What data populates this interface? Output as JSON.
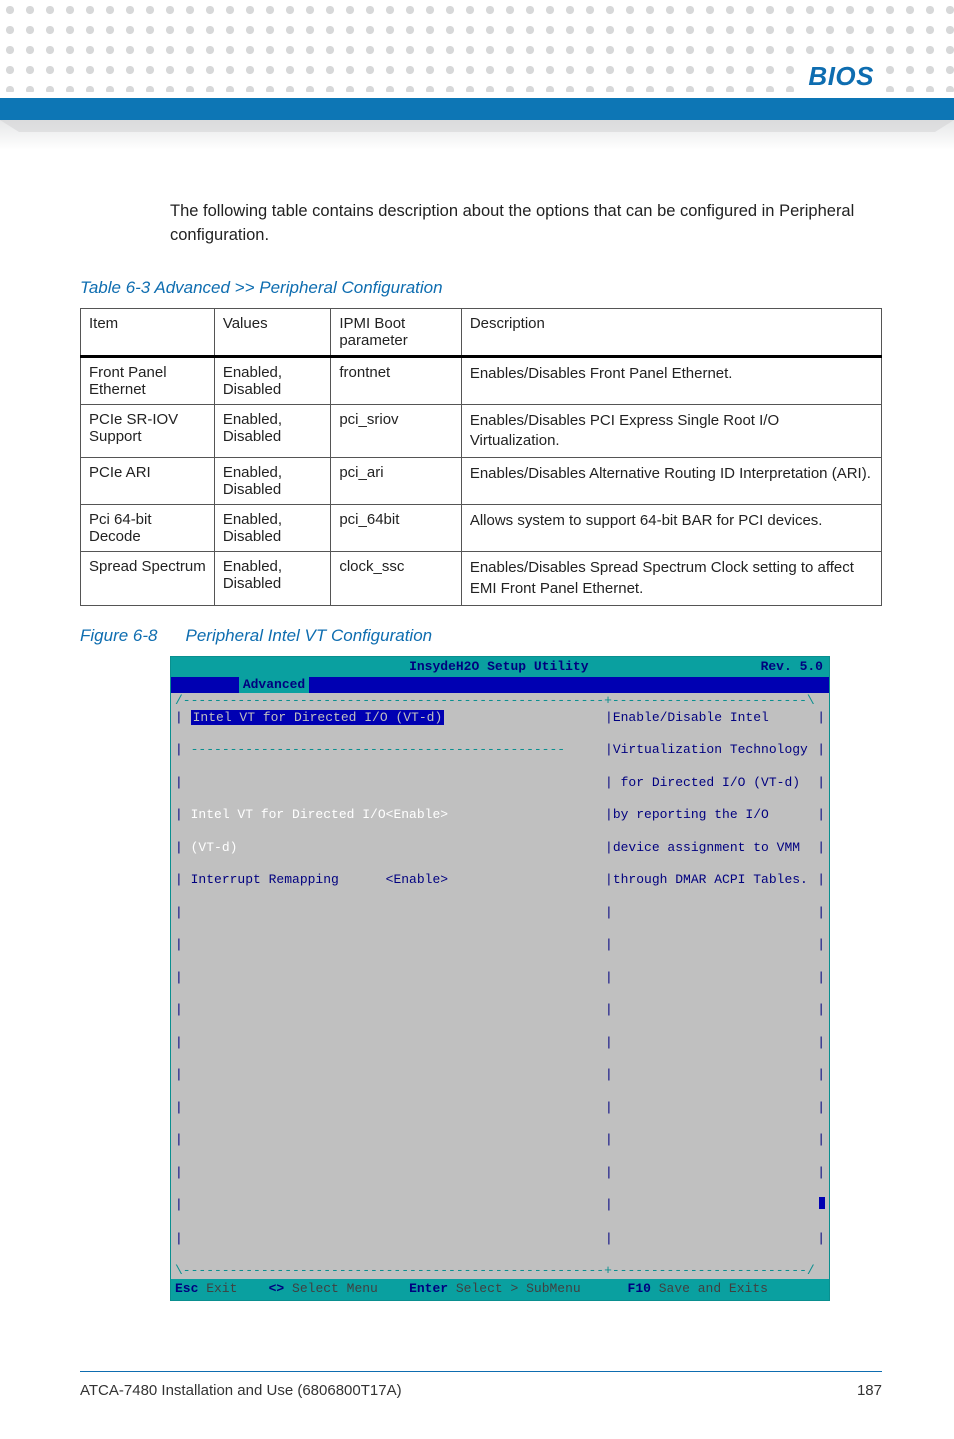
{
  "header": {
    "section": "BIOS"
  },
  "intro": "The following table contains description about the options that can be configured in Peripheral configuration.",
  "table_caption": "Table 6-3 Advanced >> Peripheral Configuration",
  "table": {
    "headers": [
      "Item",
      "Values",
      "IPMI Boot parameter",
      "Description"
    ],
    "rows": [
      {
        "item": "Front Panel Ethernet",
        "values": "Enabled, Disabled",
        "ipmi": "frontnet",
        "desc": "Enables/Disables Front Panel Ethernet."
      },
      {
        "item": "PCIe SR-IOV Support",
        "values": "Enabled, Disabled",
        "ipmi": "pci_sriov",
        "desc": "Enables/Disables PCI Express Single Root I/O Virtualization."
      },
      {
        "item": "PCIe ARI",
        "values": "Enabled, Disabled",
        "ipmi": "pci_ari",
        "desc": "Enables/Disables Alternative Routing ID Interpretation (ARI)."
      },
      {
        "item": "Pci 64-bit Decode",
        "values": "Enabled, Disabled",
        "ipmi": "pci_64bit",
        "desc": "Allows system to support 64-bit BAR for PCI devices."
      },
      {
        "item": "Spread Spectrum",
        "values": "Enabled, Disabled",
        "ipmi": "clock_ssc",
        "desc": "Enables/Disables Spread Spectrum Clock setting to affect EMI Front Panel Ethernet."
      }
    ]
  },
  "figure_caption_a": "Figure 6-8",
  "figure_caption_b": "Peripheral Intel VT Configuration",
  "bios": {
    "title_mid": "InsydeH2O Setup Utility",
    "title_right": "Rev. 5.0",
    "tab": "Advanced",
    "heading": "Intel VT for Directed I/O (VT-d)",
    "opt1_label": "Intel VT for Directed I/O",
    "opt1_value": "<Enable>",
    "opt1_sub": "(VT-d)",
    "opt2_label": "Interrupt Remapping",
    "opt2_value": "<Enable>",
    "help": [
      "Enable/Disable Intel",
      "Virtualization Technology",
      " for Directed I/O (VT-d)",
      "by reporting the I/O",
      "device assignment to VMM",
      "through DMAR ACPI Tables."
    ],
    "foot": {
      "esc": "Esc",
      "esc_t": " Exit    ",
      "arrows": "<>",
      "arrows_t": " Select Menu    ",
      "enter": "Enter",
      "enter_t": " Select > SubMenu      ",
      "f10": "F10",
      "f10_t": " Save and Exits  "
    }
  },
  "footer": {
    "doc": "ATCA-7480 Installation and Use (6806800T17A)",
    "page": "187"
  }
}
